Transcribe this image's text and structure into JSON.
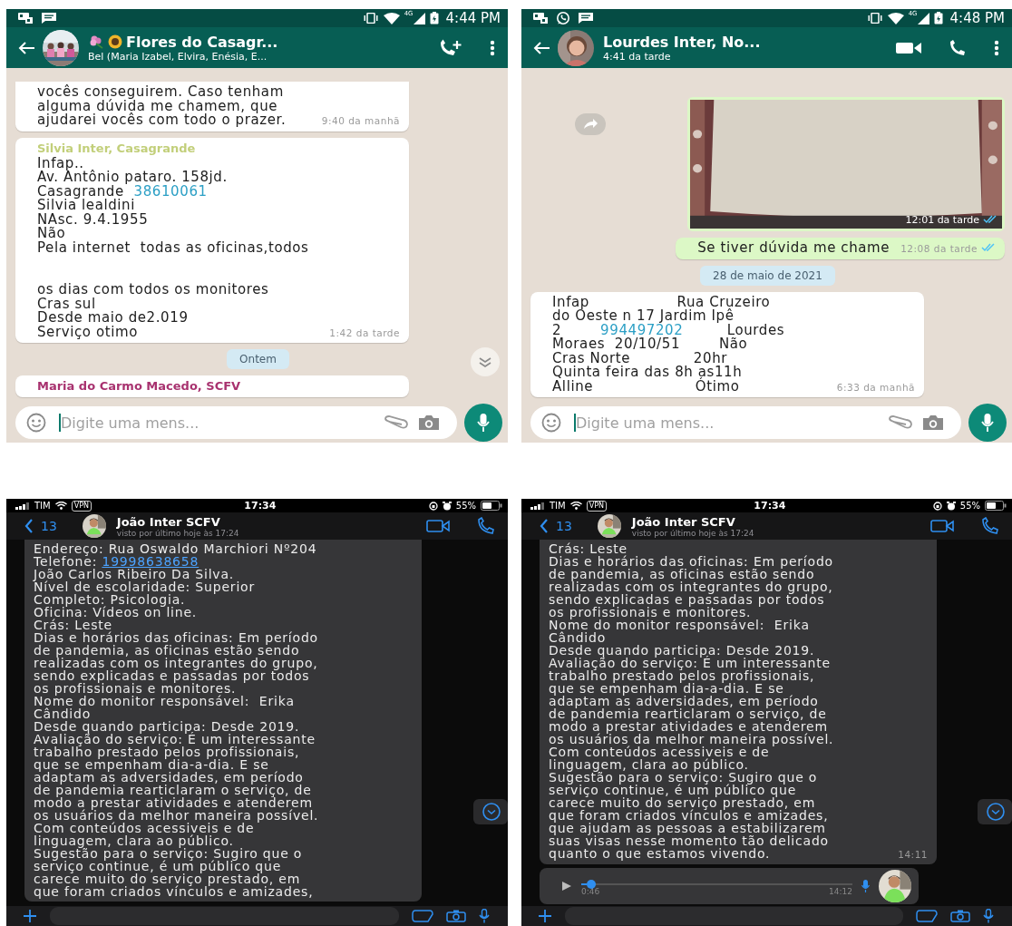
{
  "panels": [
    {
      "kind": "android",
      "status_bar": {
        "notifications": [
          {
            "kind": "app"
          },
          {
            "kind": "message"
          }
        ],
        "network": "4G",
        "time": "4:44 PM"
      },
      "header": {
        "title": "Flores do Casagr...",
        "title_icons": [
          {
            "kind": "flower"
          },
          {
            "kind": "sunflower"
          }
        ],
        "subtitle": "Bel (Maria Izabel, Elvira, Enésia, E...",
        "actions": [
          {
            "kind": "add-call"
          },
          {
            "kind": "more"
          }
        ]
      },
      "messages": [
        {
          "kind": "text",
          "outgoing": false,
          "paragraphs": [
            [
              "vocês conseguirem. Caso tenham",
              "alguma dúvida me chamem, que",
              "ajudarei vocês com todo o prazer."
            ]
          ],
          "time": "9:40 da manhã"
        },
        {
          "kind": "text",
          "outgoing": false,
          "sender": "Silvia Inter, Casagrande",
          "color": "#c2cf7a",
          "paragraphs": [
            [
              "Infap..",
              "Av. Antônio pataro. 158jd.",
              [
                {
                  "text": "Casagrande  "
                },
                {
                  "text": "38610061",
                  "kind": "link"
                }
              ],
              "Silvia lealdini",
              "NAsc. 9.4.1955",
              "Não",
              "Pela internet  todas as oficinas,todos"
            ],
            [
              "os dias com todos os monitores",
              "Cras sul",
              "Desde maio de2.019",
              "Serviço otimo"
            ]
          ],
          "time": "1:42 da tarde"
        },
        {
          "kind": "date",
          "text": "Ontem"
        },
        {
          "kind": "text",
          "outgoing": false,
          "sender": "Maria do Carmo Macedo, SCFV",
          "color": "#a8326f"
        }
      ],
      "scroll_button": true,
      "input": {
        "placeholder": "Digite uma mens..."
      }
    },
    {
      "kind": "android",
      "status_bar": {
        "notifications": [
          {
            "kind": "app"
          },
          {
            "kind": "chat"
          },
          {
            "kind": "message"
          }
        ],
        "network": "4G",
        "time": "4:48 PM"
      },
      "header": {
        "title": "Lourdes Inter, No...",
        "subtitle": "4:41 da tarde",
        "actions": [
          {
            "kind": "video"
          },
          {
            "kind": "call"
          },
          {
            "kind": "more"
          }
        ]
      },
      "messages": [
        {
          "outgoing": true,
          "forward_button": true,
          "time": "12:01 da tarde",
          "read": true
        },
        {
          "kind": "text",
          "outgoing": true,
          "paragraphs": [
            [
              "Se tiver dúvida me chame"
            ]
          ],
          "time": "12:08 da tarde",
          "read": true
        },
        {
          "kind": "date",
          "text": "28 de maio de 2021"
        },
        {
          "kind": "text",
          "outgoing": false,
          "paragraphs": [
            [
              "Infap                  Rua Cruzeiro",
              "do Oeste n 17 Jardim Ipê",
              [
                {
                  "text": "2        "
                },
                {
                  "text": "994497202",
                  "kind": "link"
                },
                {
                  "text": "         Lourdes"
                }
              ],
              "Moraes  20/10/51        Não",
              "Cras Norte             20hr",
              "Quinta feira das 8h as11h",
              "Alline                     Ótimo"
            ]
          ],
          "time": "6:33 da manhã"
        }
      ],
      "input": {
        "placeholder": "Digite uma mens..."
      }
    },
    {
      "kind": "ios",
      "status_bar": {
        "carrier": "TIM",
        "vpn": "VPN",
        "time": "17:34",
        "battery": "55%"
      },
      "header": {
        "back_count": "13",
        "title": "João Inter SCFV",
        "subtitle": "visto por último hoje às 17:24",
        "actions": [
          {
            "kind": "video"
          },
          {
            "kind": "call"
          }
        ]
      },
      "messages": [
        {
          "kind": "text",
          "outgoing": false,
          "paragraphs": [
            [
              "Endereço: Rua Oswaldo Marchiori Nº204",
              [
                {
                  "text": "Telefone: "
                },
                {
                  "text": "19998638658",
                  "kind": "link"
                }
              ],
              "João Carlos Ribeiro Da Silva.",
              "Nível de escolaridade: Superior",
              "Completo: Psicologia.",
              "Oficina: Vídeos on line.",
              "Crás: Leste",
              "Dias e horários das oficinas: Em período",
              "de pandemia, as oficinas estão sendo",
              "realizadas com os integrantes do grupo,",
              "sendo explicadas e passadas por todos",
              "os profissionais e monitores.",
              "Nome do monitor responsável:  Erika",
              "Cândido",
              "Desde quando participa: Desde 2019.",
              "Avaliação do serviço: É um interessante",
              "trabalho prestado pelos profissionais,",
              "que se empenham dia-a-dia. E se",
              "adaptam as adversidades, em período",
              "de pandemia rearticlaram o serviço, de",
              "modo a prestar atividades e atenderem",
              "os usuários da melhor maneira possível.",
              "Com conteúdos acessiveis e de",
              "linguagem, clara ao público.",
              "Sugestão para o serviço: Sugiro que o",
              "serviço continue, é um público que",
              "carece muito do serviço prestado, em",
              "que foram criados vínculos e amizades,"
            ]
          ]
        }
      ],
      "scroll_button": true
    },
    {
      "kind": "ios",
      "status_bar": {
        "carrier": "TIM",
        "vpn": "VPN",
        "time": "17:34",
        "battery": "55%"
      },
      "header": {
        "back_count": "13",
        "title": "João Inter SCFV",
        "subtitle": "visto por último hoje às 17:24",
        "actions": [
          {
            "kind": "video"
          },
          {
            "kind": "call"
          }
        ]
      },
      "messages": [
        {
          "kind": "text",
          "outgoing": false,
          "paragraphs": [
            [
              "Crás: Leste",
              "Dias e horários das oficinas: Em período",
              "de pandemia, as oficinas estão sendo",
              "realizadas com os integrantes do grupo,",
              "sendo explicadas e passadas por todos",
              "os profissionais e monitores.",
              "Nome do monitor responsável:  Erika",
              "Cândido",
              "Desde quando participa: Desde 2019.",
              "Avaliação do serviço: É um interessante",
              "trabalho prestado pelos profissionais,",
              "que se empenham dia-a-dia. E se",
              "adaptam as adversidades, em período",
              "de pandemia rearticlaram o serviço, de",
              "modo a prestar atividades e atenderem",
              "os usuários da melhor maneira possível.",
              "Com conteúdos acessiveis e de",
              "linguagem, clara ao público.",
              "Sugestão para o serviço: Sugiro que o",
              "serviço continue, é um público que",
              "carece muito do serviço prestado, em",
              "que foram criados vínculos e amizades,",
              "que ajudam as pessoas a estabilizarem",
              "suas visas nesse momento tão delicado",
              "quanto o que estamos vivendo."
            ]
          ],
          "time": "14:11"
        },
        {
          "kind": "voice",
          "outgoing": false,
          "level": 0.02,
          "duration": "0:46",
          "time": "14:12"
        }
      ],
      "scroll_button": true
    }
  ]
}
